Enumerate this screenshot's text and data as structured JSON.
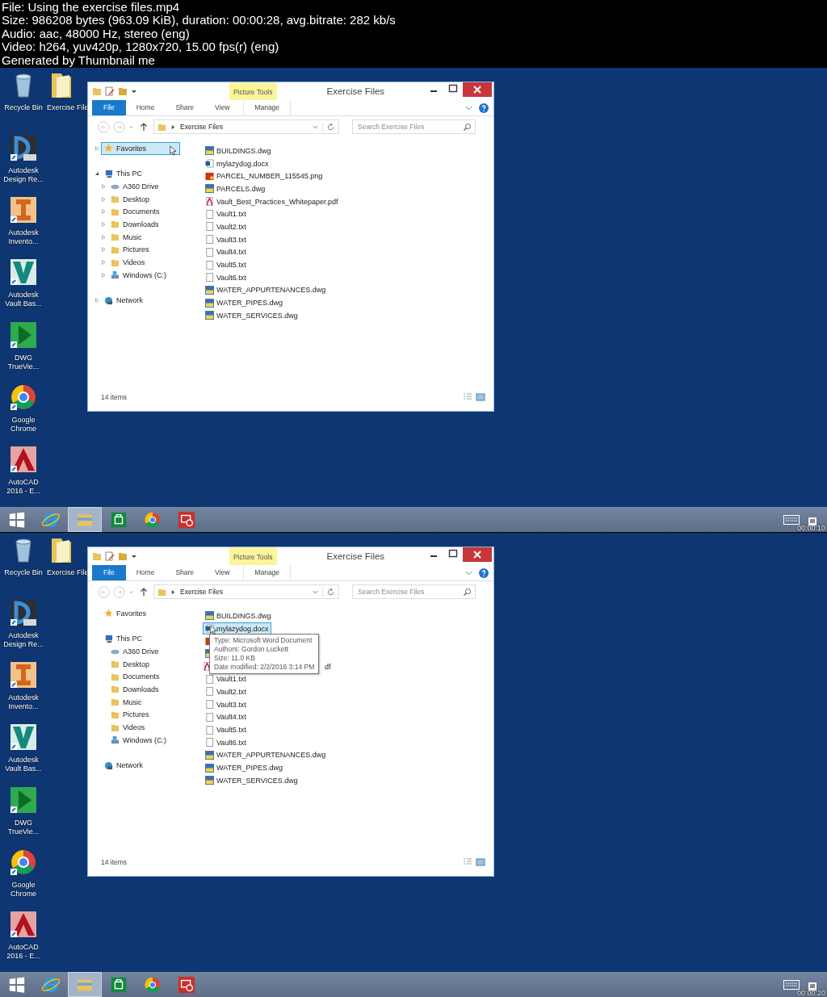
{
  "header": {
    "lines": [
      "File: Using the exercise files.mp4",
      "Size: 986208 bytes (963.09 KiB), duration: 00:00:28, avg.bitrate: 282 kb/s",
      "Audio: aac, 48000 Hz, stereo (eng)",
      "Video: h264, yuv420p, 1280x720, 15.00 fps(r) (eng)",
      "Generated by Thumbnail me"
    ]
  },
  "frames": [
    {
      "desktop_icons": [
        {
          "label": "Recycle Bin",
          "kind": "recycle"
        },
        {
          "label": "Exercise File",
          "kind": "folder"
        },
        {
          "label": "Autodesk Design Re...",
          "kind": "design-review"
        },
        {
          "label": "Autodesk Invento...",
          "kind": "inventor"
        },
        {
          "label": "Autodesk Vault Bas...",
          "kind": "vault"
        },
        {
          "label": "DWG TrueVie...",
          "kind": "dwg-viewer"
        },
        {
          "label": "Google Chrome",
          "kind": "chrome"
        },
        {
          "label": "AutoCAD 2016 - E...",
          "kind": "autocad"
        }
      ],
      "window": {
        "title": "Exercise Files",
        "contextual_tab": "Picture Tools",
        "ribbon_tabs": [
          {
            "label": "File",
            "selected": true
          },
          {
            "label": "Home",
            "selected": false
          },
          {
            "label": "Share",
            "selected": false
          },
          {
            "label": "View",
            "selected": false
          },
          {
            "label": "Manage",
            "selected": false
          }
        ],
        "address": "Exercise Files",
        "search_placeholder": "Search Exercise Files",
        "expanders_visible": true,
        "nav": [
          {
            "label": "Favorites",
            "kind": "favorites",
            "hovered": true,
            "expanded": false
          },
          {
            "label": "This PC",
            "kind": "pc",
            "hovered": false,
            "expanded": true,
            "children": [
              {
                "label": "A360 Drive",
                "kind": "cloud",
                "hovered": false,
                "expanded": false
              },
              {
                "label": "Desktop",
                "kind": "folder",
                "hovered": false,
                "expanded": false
              },
              {
                "label": "Documents",
                "kind": "folder",
                "hovered": false,
                "expanded": false
              },
              {
                "label": "Downloads",
                "kind": "folder",
                "hovered": false,
                "expanded": false
              },
              {
                "label": "Music",
                "kind": "folder",
                "hovered": false,
                "expanded": false
              },
              {
                "label": "Pictures",
                "kind": "folder",
                "hovered": false,
                "expanded": false
              },
              {
                "label": "Videos",
                "kind": "folder",
                "hovered": false,
                "expanded": false
              },
              {
                "label": "Windows (C:)",
                "kind": "drive",
                "hovered": false,
                "expanded": false
              }
            ]
          },
          {
            "label": "Network",
            "kind": "network",
            "hovered": false,
            "expanded": false
          }
        ],
        "files": [
          {
            "name": "BUILDINGS.dwg",
            "kind": "dwg",
            "hovered": false
          },
          {
            "name": "mylazydog.docx",
            "kind": "docx",
            "hovered": false
          },
          {
            "name": "PARCEL_NUMBER_115545.png",
            "kind": "png",
            "hovered": false
          },
          {
            "name": "PARCELS.dwg",
            "kind": "dwg",
            "hovered": false
          },
          {
            "name": "Vault_Best_Practices_Whitepaper.pdf",
            "kind": "pdf",
            "hovered": false
          },
          {
            "name": "Vault1.txt",
            "kind": "txt",
            "hovered": false
          },
          {
            "name": "Vault2.txt",
            "kind": "txt",
            "hovered": false
          },
          {
            "name": "Vault3.txt",
            "kind": "txt",
            "hovered": false
          },
          {
            "name": "Vault4.txt",
            "kind": "txt",
            "hovered": false
          },
          {
            "name": "Vault5.txt",
            "kind": "txt",
            "hovered": false
          },
          {
            "name": "Vault6.txt",
            "kind": "txt",
            "hovered": false
          },
          {
            "name": "WATER_APPURTENANCES.dwg",
            "kind": "dwg",
            "hovered": false
          },
          {
            "name": "WATER_PIPES.dwg",
            "kind": "dwg",
            "hovered": false
          },
          {
            "name": "WATER_SERVICES.dwg",
            "kind": "dwg",
            "hovered": false
          }
        ],
        "status": "14 items"
      },
      "taskbar": [
        {
          "kind": "start",
          "selected": false
        },
        {
          "kind": "ie",
          "selected": false
        },
        {
          "kind": "explorer",
          "selected": true
        },
        {
          "kind": "store",
          "selected": false
        },
        {
          "kind": "chrome",
          "selected": false
        },
        {
          "kind": "remote",
          "selected": false
        }
      ],
      "timestamp": "00:00:10"
    },
    {
      "desktop_icons": [
        {
          "label": "Recycle Bin",
          "kind": "recycle"
        },
        {
          "label": "Exercise File",
          "kind": "folder"
        },
        {
          "label": "Autodesk Design Re...",
          "kind": "design-review"
        },
        {
          "label": "Autodesk Invento...",
          "kind": "inventor"
        },
        {
          "label": "Autodesk Vault Bas...",
          "kind": "vault"
        },
        {
          "label": "DWG TrueVie...",
          "kind": "dwg-viewer"
        },
        {
          "label": "Google Chrome",
          "kind": "chrome"
        },
        {
          "label": "AutoCAD 2016 - E...",
          "kind": "autocad"
        }
      ],
      "window": {
        "title": "Exercise Files",
        "contextual_tab": "Picture Tools",
        "ribbon_tabs": [
          {
            "label": "File",
            "selected": true
          },
          {
            "label": "Home",
            "selected": false
          },
          {
            "label": "Share",
            "selected": false
          },
          {
            "label": "View",
            "selected": false
          },
          {
            "label": "Manage",
            "selected": false
          }
        ],
        "address": "Exercise Files",
        "search_placeholder": "Search Exercise Files",
        "expanders_visible": false,
        "nav": [
          {
            "label": "Favorites",
            "kind": "favorites",
            "hovered": false
          },
          {
            "label": "This PC",
            "kind": "pc",
            "hovered": false,
            "children": [
              {
                "label": "A360 Drive",
                "kind": "cloud",
                "hovered": false
              },
              {
                "label": "Desktop",
                "kind": "folder",
                "hovered": false
              },
              {
                "label": "Documents",
                "kind": "folder",
                "hovered": false
              },
              {
                "label": "Downloads",
                "kind": "folder",
                "hovered": false
              },
              {
                "label": "Music",
                "kind": "folder",
                "hovered": false
              },
              {
                "label": "Pictures",
                "kind": "folder",
                "hovered": false
              },
              {
                "label": "Videos",
                "kind": "folder",
                "hovered": false
              },
              {
                "label": "Windows (C:)",
                "kind": "drive",
                "hovered": false
              }
            ]
          },
          {
            "label": "Network",
            "kind": "network",
            "hovered": false
          }
        ],
        "files": [
          {
            "name": "BUILDINGS.dwg",
            "kind": "dwg",
            "hovered": false
          },
          {
            "name": "mylazydog.docx",
            "kind": "docx",
            "hovered": true,
            "tooltip": [
              "Type: Microsoft Word Document",
              "Authors: Gordon Luckett",
              "Size: 11.0 KB",
              "Date modified: 2/2/2016 3:14 PM"
            ]
          },
          {
            "kind": "png"
          },
          {
            "kind": "dwg"
          },
          {
            "name_end": "df",
            "kind": "pdf"
          },
          {
            "name": "Vault1.txt",
            "kind": "txt",
            "hovered": false
          },
          {
            "name": "Vault2.txt",
            "kind": "txt",
            "hovered": false
          },
          {
            "name": "Vault3.txt",
            "kind": "txt",
            "hovered": false
          },
          {
            "name": "Vault4.txt",
            "kind": "txt",
            "hovered": false
          },
          {
            "name": "Vault5.txt",
            "kind": "txt",
            "hovered": false
          },
          {
            "name": "Vault6.txt",
            "kind": "txt",
            "hovered": false
          },
          {
            "name": "WATER_APPURTENANCES.dwg",
            "kind": "dwg",
            "hovered": false
          },
          {
            "name": "WATER_PIPES.dwg",
            "kind": "dwg",
            "hovered": false
          },
          {
            "name": "WATER_SERVICES.dwg",
            "kind": "dwg",
            "hovered": false
          }
        ],
        "status": "14 items"
      },
      "taskbar": [
        {
          "kind": "start",
          "selected": false
        },
        {
          "kind": "ie",
          "selected": false
        },
        {
          "kind": "explorer",
          "selected": true
        },
        {
          "kind": "store",
          "selected": false
        },
        {
          "kind": "chrome",
          "selected": false
        },
        {
          "kind": "remote",
          "selected": false
        }
      ],
      "timestamp": "00:00:20"
    }
  ]
}
